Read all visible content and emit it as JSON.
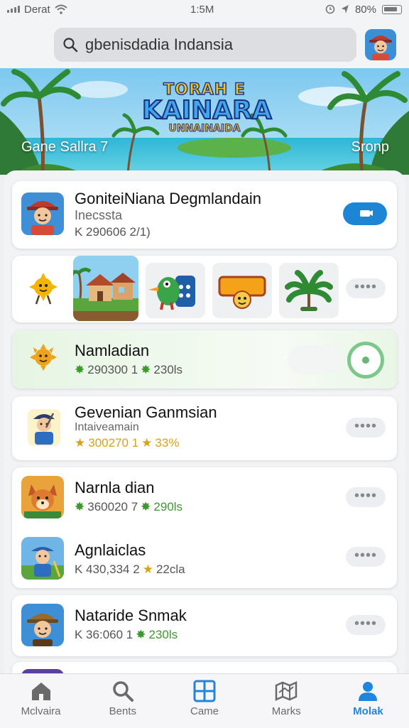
{
  "status": {
    "carrier": "Derat",
    "time": "1:5M",
    "battery": "80%"
  },
  "search": {
    "value": "gbenisdadia Indansia"
  },
  "banner": {
    "title_top": "TORAH  E",
    "title_main": "KAINARA",
    "title_sub": "UNNAINAIDA",
    "left_label": "Gane Sallra  7",
    "right_label": "Sronp"
  },
  "cards": [
    {
      "title": "GoniteiNiana Degmlandain",
      "subtitle": "Inecssta",
      "meta": "K 290606 2/1)"
    },
    {
      "title": "Namladian",
      "meta_a": "290300 1",
      "meta_b": "230ls"
    },
    {
      "title": "Gevenian Ganmsian",
      "subtitle": "Intaiveamain",
      "meta_a": "300270 1",
      "meta_b": "33%"
    },
    {
      "title": "Narnla dian",
      "meta_a": "360020 7",
      "meta_b": "290ls"
    },
    {
      "title": "Agnlaiclas",
      "meta_a": "K 430,334 2",
      "meta_b": "22cla"
    },
    {
      "title": "Nataride Snmak",
      "meta_a": "K 36:060 1",
      "meta_b": "230ls"
    }
  ],
  "more_label": "••••",
  "tabs": [
    {
      "label": "Mclvaira"
    },
    {
      "label": "Bents"
    },
    {
      "label": "Came"
    },
    {
      "label": "Marks"
    },
    {
      "label": "Molak"
    }
  ],
  "colors": {
    "accent": "#1f86e0",
    "green": "#3c9a2c",
    "gold": "#d7a314"
  }
}
